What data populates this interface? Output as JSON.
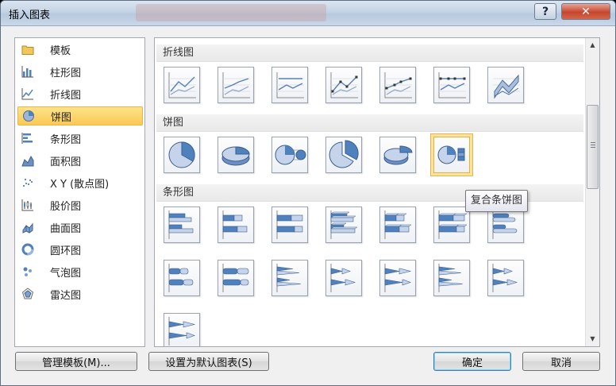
{
  "window": {
    "title": "插入图表",
    "help": "?",
    "close": "✕"
  },
  "chart_types": [
    {
      "label": "模板",
      "icon": "folder-icon"
    },
    {
      "label": "柱形图",
      "icon": "column-chart-icon"
    },
    {
      "label": "折线图",
      "icon": "line-chart-icon"
    },
    {
      "label": "饼图",
      "icon": "pie-chart-icon",
      "selected": true
    },
    {
      "label": "条形图",
      "icon": "bar-chart-icon"
    },
    {
      "label": "面积图",
      "icon": "area-chart-icon"
    },
    {
      "label": "X Y (散点图)",
      "icon": "scatter-chart-icon"
    },
    {
      "label": "股价图",
      "icon": "stock-chart-icon"
    },
    {
      "label": "曲面图",
      "icon": "surface-chart-icon"
    },
    {
      "label": "圆环图",
      "icon": "doughnut-chart-icon"
    },
    {
      "label": "气泡图",
      "icon": "bubble-chart-icon"
    },
    {
      "label": "雷达图",
      "icon": "radar-chart-icon"
    }
  ],
  "sections": [
    {
      "title": "折线图",
      "thumbs": [
        "line",
        "stacked-line",
        "100-stacked-line",
        "line-markers",
        "stacked-line-markers",
        "100-stacked-line-markers",
        "3d-line"
      ]
    },
    {
      "title": "饼图",
      "thumbs": [
        "pie",
        "3d-pie",
        "pie-of-pie",
        "exploded-pie",
        "exploded-3d-pie",
        "bar-of-pie"
      ],
      "selected": "bar-of-pie"
    },
    {
      "title": "条形图",
      "thumbs": [
        "clustered-bar",
        "stacked-bar",
        "100-stacked-bar",
        "3d-clustered-bar",
        "3d-stacked-bar",
        "3d-100-stacked-bar",
        "clustered-cylinder-bar",
        "stacked-cylinder-bar",
        "100-stacked-cylinder-bar",
        "clustered-cone-bar",
        "stacked-cone-bar",
        "100-stacked-cone-bar",
        "clustered-pyramid-bar",
        "stacked-pyramid-bar",
        "100-stacked-pyramid-bar"
      ]
    }
  ],
  "tooltip": "复合条饼图",
  "buttons": {
    "manage_templates": "管理模板(M)...",
    "set_default": "设置为默认图表(S)",
    "ok": "确定",
    "cancel": "取消"
  },
  "colors": {
    "accent": "#4f81bd",
    "selection": "#fcc955"
  }
}
